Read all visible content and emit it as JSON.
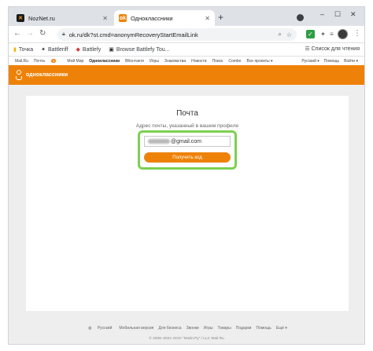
{
  "browser": {
    "tabs": [
      {
        "title": "NozNet.ru",
        "icon": "noznet-favicon-icon",
        "active": false
      },
      {
        "title": "Одноклассники",
        "icon": "ok-favicon-icon",
        "active": true
      }
    ],
    "new_tab_symbol": "+",
    "window_controls": [
      "–",
      "☐",
      "✕"
    ],
    "url": "ok.ru/dk?st.cmd=anonymRecoveryStartEmailLink",
    "bookmarks": [
      {
        "label": "Точка",
        "icon": "folder-icon"
      },
      {
        "label": "Battleriff",
        "icon": "battleriff-icon"
      },
      {
        "label": "Battlefy",
        "icon": "battlefy-icon"
      },
      {
        "label": "Browse Battlefy Tou...",
        "icon": "battlefy-page-icon"
      }
    ],
    "reading_list": "Список для чтения"
  },
  "site": {
    "topnav": {
      "links": [
        "Mail.Ru",
        "Почта",
        "Мой Мир",
        "Одноклассники",
        "ВКонтакте",
        "Игры",
        "Знакомства",
        "Новости",
        "Поиск",
        "Combo",
        "Все проекты ▾"
      ],
      "mail_badge": "6",
      "right_links": [
        "Русский ▾",
        "Помощь",
        "Войти ▾"
      ]
    },
    "brand": "одноклассники",
    "accent": "#ee8208"
  },
  "form": {
    "title": "Почта",
    "subtitle": "Адрес почты, указанный в вашем профиле",
    "email_suffix": "@gmail.com",
    "submit_label": "Получить код",
    "highlight_color": "#7dd052"
  },
  "footer": {
    "links": [
      "Русский",
      "Мобильная версия",
      "Для бизнеса",
      "Звонки",
      "Игры",
      "Товары",
      "Подарки",
      "Помощь",
      "Ещё ▾"
    ],
    "copyright": "© 2006–2021 ООО \"Мэйл.Ру\" / LLC Mail.Ru"
  }
}
